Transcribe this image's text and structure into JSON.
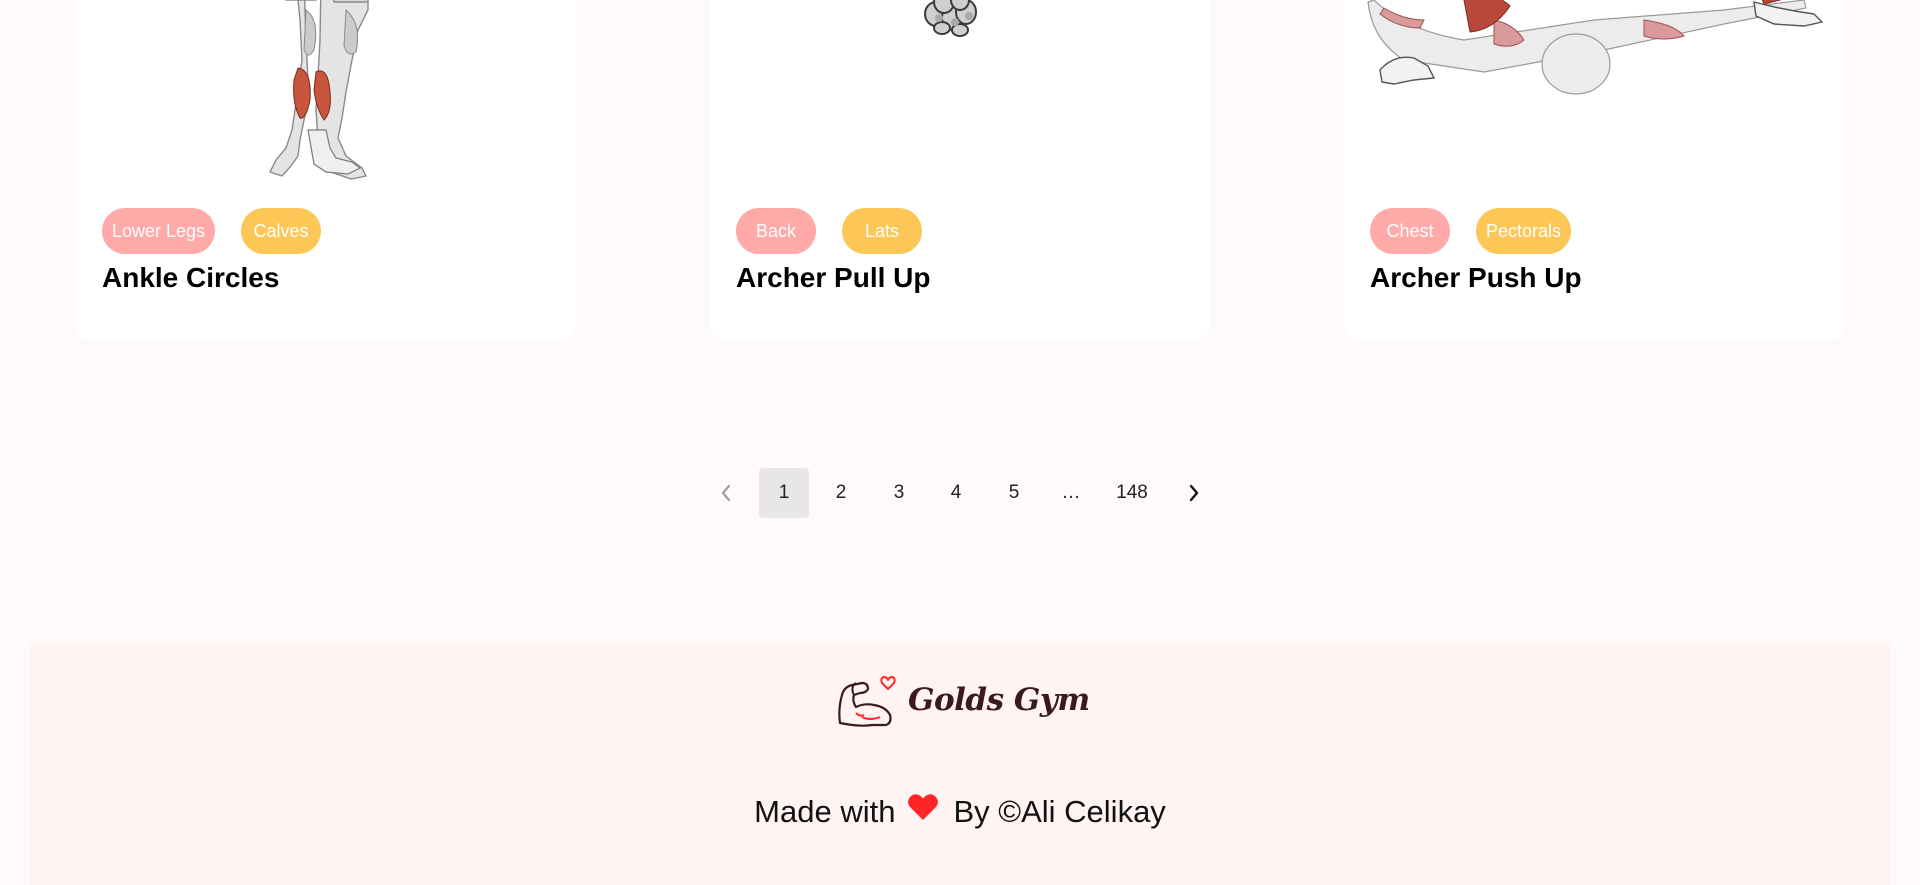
{
  "cards": [
    {
      "body_part": "Lower Legs",
      "target": "Calves",
      "name": "Ankle Circles",
      "image_icon": "lower-legs-illustration"
    },
    {
      "body_part": "Back",
      "target": "Lats",
      "name": "Archer Pull Up",
      "image_icon": "hands-gripping-illustration"
    },
    {
      "body_part": "Chest",
      "target": "Pectorals",
      "name": "Archer Push Up",
      "image_icon": "push-up-illustration"
    }
  ],
  "pagination": {
    "prev_icon": "chevron-left-icon",
    "next_icon": "chevron-right-icon",
    "pages": [
      "1",
      "2",
      "3",
      "4",
      "5",
      "…",
      "148"
    ],
    "current_page": "1"
  },
  "footer": {
    "brand": "Golds Gym",
    "credit_prefix": "Made with",
    "credit_suffix": "By ©Ali Celikay",
    "heart_icon": "heart-icon",
    "logo_icon": "flexed-arm-heart-icon"
  },
  "colors": {
    "page_background": "#fffafa",
    "body_part_tag": "#ffa9a9",
    "target_tag": "#fcc757",
    "footer_background": "#fff3f3",
    "heart": "#ff2625",
    "brand_text": "#3b1a1f"
  }
}
